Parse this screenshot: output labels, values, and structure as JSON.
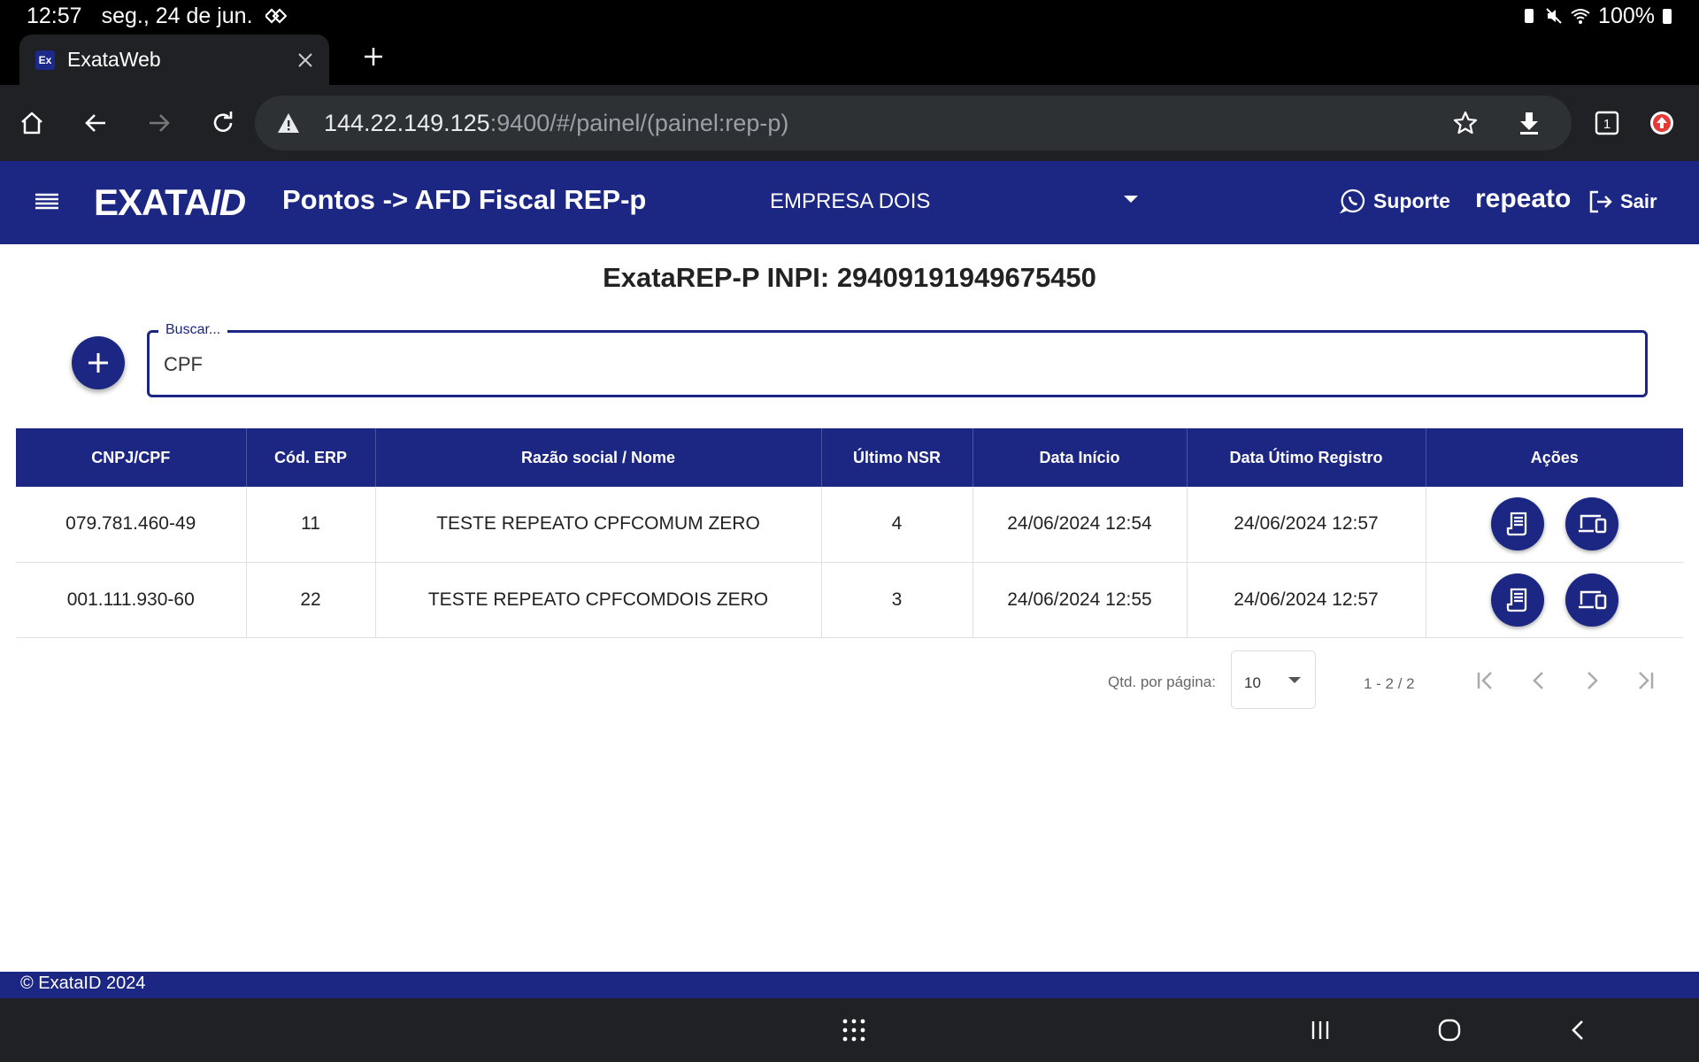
{
  "status_bar": {
    "time": "12:57",
    "date": "seg., 24 de jun.",
    "battery": "100%"
  },
  "browser": {
    "tab_title": "ExataWeb",
    "favicon_text": "Ex",
    "url_host": "144.22.149.125",
    "url_path": ":9400/#/painel/(painel:rep-p)",
    "tab_count": "1"
  },
  "header": {
    "logo_text": "EXATA",
    "logo_italic": "ID",
    "title": "Pontos -> AFD Fiscal REP-p",
    "company": "EMPRESA DOIS",
    "support_label": "Suporte",
    "username": "repeato",
    "logout_label": "Sair"
  },
  "main": {
    "heading": "ExataREP-P INPI: 29409191949675450",
    "search": {
      "label": "Buscar...",
      "value": "CPF"
    }
  },
  "table": {
    "columns": [
      "CNPJ/CPF",
      "Cód. ERP",
      "Razão social / Nome",
      "Último NSR",
      "Data Início",
      "Data Útimo Registro",
      "Ações"
    ],
    "rows": [
      {
        "cnpj_cpf": "079.781.460-49",
        "cod_erp": "11",
        "nome": "TESTE REPEATO CPFCOMUM ZERO",
        "ultimo_nsr": "4",
        "data_inicio": "24/06/2024 12:54",
        "data_ultimo": "24/06/2024 12:57"
      },
      {
        "cnpj_cpf": "001.111.930-60",
        "cod_erp": "22",
        "nome": "TESTE REPEATO CPFCOMDOIS ZERO",
        "ultimo_nsr": "3",
        "data_inicio": "24/06/2024 12:55",
        "data_ultimo": "24/06/2024 12:57"
      }
    ]
  },
  "paginator": {
    "label": "Qtd. por página:",
    "page_size": "10",
    "range": "1 - 2 / 2"
  },
  "footer": {
    "text": "© ExataID 2024"
  },
  "colors": {
    "primary": "#1c2683",
    "browser_dark": "#202124"
  }
}
